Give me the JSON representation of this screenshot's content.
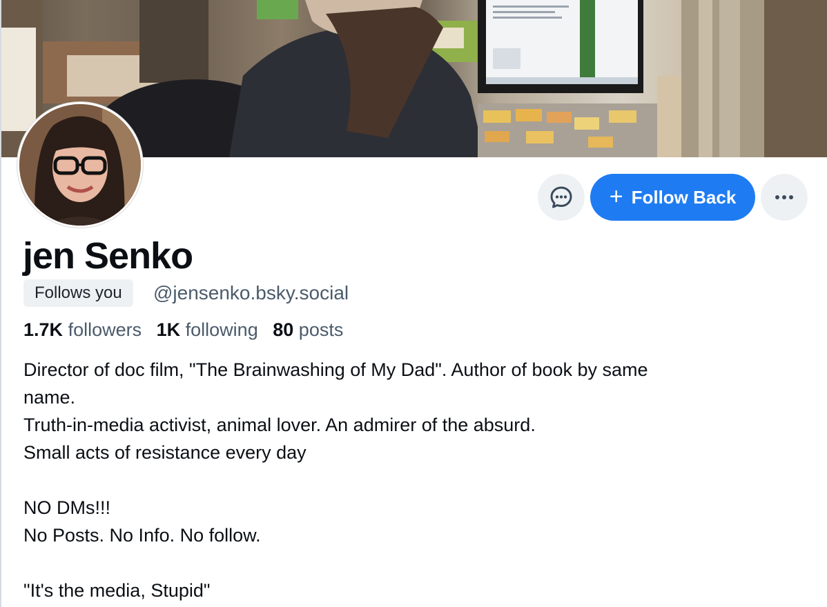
{
  "profile": {
    "display_name": "jen Senko",
    "follows_you_label": "Follows you",
    "handle": "@jensenko.bsky.social"
  },
  "actions": {
    "message_icon": "chat-bubble-icon",
    "follow_back_label": "Follow Back",
    "follow_icon": "plus-icon",
    "more_icon": "ellipsis-icon"
  },
  "stats": {
    "followers_count": "1.7K",
    "followers_label": "followers",
    "following_count": "1K",
    "following_label": "following",
    "posts_count": "80",
    "posts_label": "posts"
  },
  "bio": {
    "line1": "Director of doc film, \"The Brainwashing of My Dad\". Author of book by same",
    "line2": "name.",
    "line3": "Truth-in-media activist, animal lover. An admirer of the absurd.",
    "line4": "Small acts of resistance every day",
    "line5": "NO DMs!!!",
    "line6": "No Posts. No Info. No follow.",
    "line7": "\"It's the media, Stupid\""
  },
  "colors": {
    "accent": "#1f7bf2",
    "muted_text": "#4b5b6b",
    "chip_background": "#eef1f4"
  }
}
